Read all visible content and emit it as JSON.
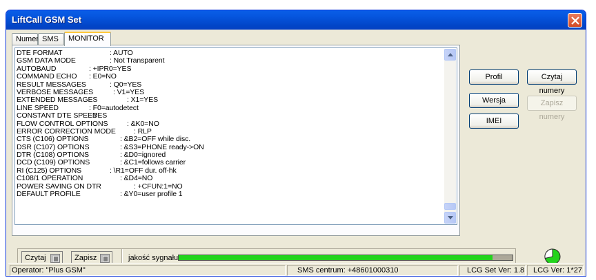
{
  "window": {
    "title": "LiftCall GSM Set"
  },
  "tabs": [
    {
      "label": "Numer"
    },
    {
      "label": "SMS"
    },
    {
      "label": "MONITOR"
    }
  ],
  "monitor": {
    "lines": [
      {
        "key": "DTE FORMAT",
        "value": ": AUTO"
      },
      {
        "key": "GSM DATA MODE",
        "value": ": Not Transparent"
      },
      {
        "key": "AUTOBAUD",
        "value": ": +IPR0=YES"
      },
      {
        "key": "COMMAND ECHO",
        "value": ": E0=NO"
      },
      {
        "key": "RESULT MESSAGES",
        "value": ": Q0=YES"
      },
      {
        "key": "VERBOSE MESSAGES",
        "value": ": V1=YES"
      },
      {
        "key": "EXTENDED MESSAGES",
        "value": ": X1=YES"
      },
      {
        "key": "LINE SPEED",
        "value": ": F0=autodetect"
      },
      {
        "key": "CONSTANT DTE SPEED",
        "value": ": YES"
      },
      {
        "key": "FLOW CONTROL OPTIONS",
        "value": ": &K0=NO"
      },
      {
        "key": "ERROR CORRECTION MODE",
        "value": ": RLP"
      },
      {
        "key": "CTS (C106) OPTIONS",
        "value": ": &B2=OFF while disc."
      },
      {
        "key": "DSR (C107) OPTIONS",
        "value": ": &S3=PHONE ready->ON"
      },
      {
        "key": "DTR (C108) OPTIONS",
        "value": ": &D0=ignored"
      },
      {
        "key": "DCD (C109) OPTIONS",
        "value": ": &C1=follows carrier"
      },
      {
        "key": "RI (C125) OPTIONS",
        "value": ": \\R1=OFF dur. off-hk"
      },
      {
        "key": "C108/1 OPERATION",
        "value": ": &D4=NO"
      },
      {
        "key": "POWER SAVING ON DTR",
        "value": ": +CFUN:1=NO"
      },
      {
        "key": "DEFAULT PROFILE",
        "value": ": &Y0=user profile 1"
      }
    ]
  },
  "buttons": {
    "profil": "Profil",
    "wersja": "Wersja",
    "imei": "IMEI",
    "czytaj_numery": "Czytaj numery",
    "zapisz_numery": "Zapisz numery"
  },
  "bottom": {
    "czytaj": "Czytaj",
    "zapisz": "Zapisz",
    "signal_label": "jakość sygnału",
    "signal_level": 0.94
  },
  "status": {
    "operator": "Operator: \"Plus GSM\"",
    "sms_center": "SMS centrum: +48601000310",
    "set_ver": "LCG Set Ver: 1.8",
    "lcg_ver": "LCG Ver: 1*27"
  },
  "colors": {
    "signal": "#22d41c",
    "titlebar": "#0245c7",
    "pie_green": "#22d41c"
  }
}
